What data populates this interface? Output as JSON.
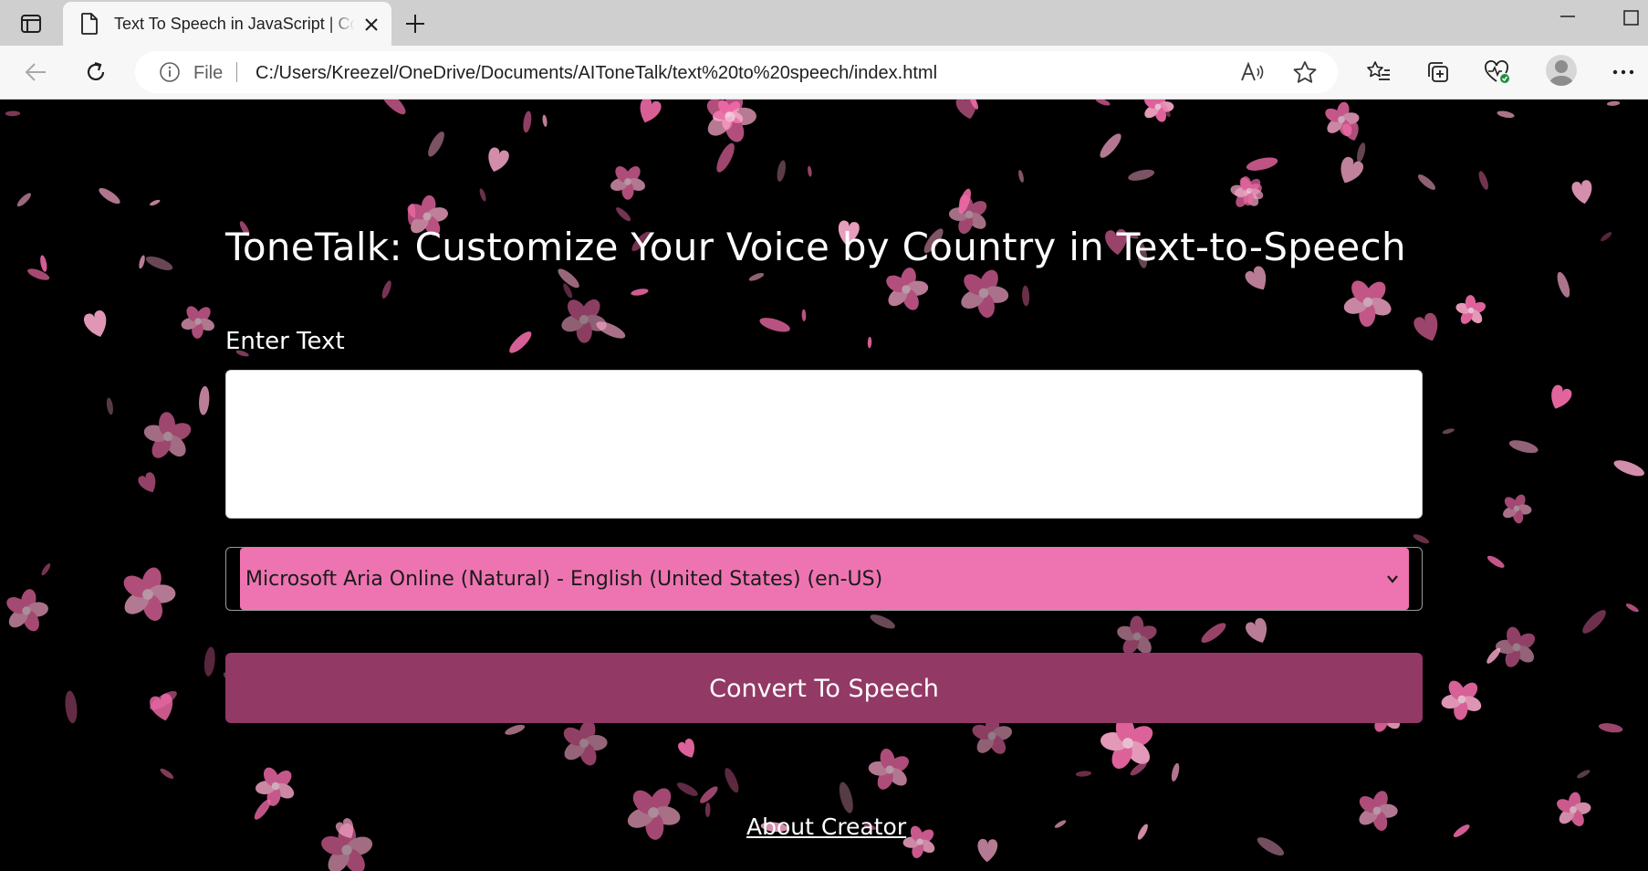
{
  "browser": {
    "tab": {
      "title": "Text To Speech in JavaScript | CodingNepal"
    },
    "address": {
      "scheme_label": "File",
      "url": "C:/Users/Kreezel/OneDrive/Documents/AIToneTalk/text%20to%20speech/index.html"
    },
    "icons": {
      "tab_actions": "tab-actions-icon",
      "tab_page": "document-icon",
      "tab_close": "close-icon",
      "new_tab": "plus-icon",
      "back": "back-arrow-icon",
      "refresh": "refresh-icon",
      "info": "info-icon",
      "read_aloud": "read-aloud-icon",
      "favorite": "star-icon",
      "favorites": "favorites-list-icon",
      "collections": "collections-icon",
      "browser_essentials": "heart-pulse-icon",
      "profile": "profile-avatar",
      "more": "more-icon"
    }
  },
  "page": {
    "headline": "ToneTalk: Customize Your Voice by Country in Text-to-Speech",
    "input_label": "Enter Text",
    "textarea_value": "",
    "voice_select_value": "Microsoft Aria Online (Natural) - English (United States) (en-US)",
    "convert_button_label": "Convert To Speech",
    "about_link_label": "About Creator"
  },
  "colors": {
    "page_background": "#000000",
    "select_background": "#ee74b1",
    "button_background": "#933966",
    "petal_pink": "#f06ba8",
    "petal_light": "#f7a6c8",
    "text_white": "#ffffff"
  }
}
